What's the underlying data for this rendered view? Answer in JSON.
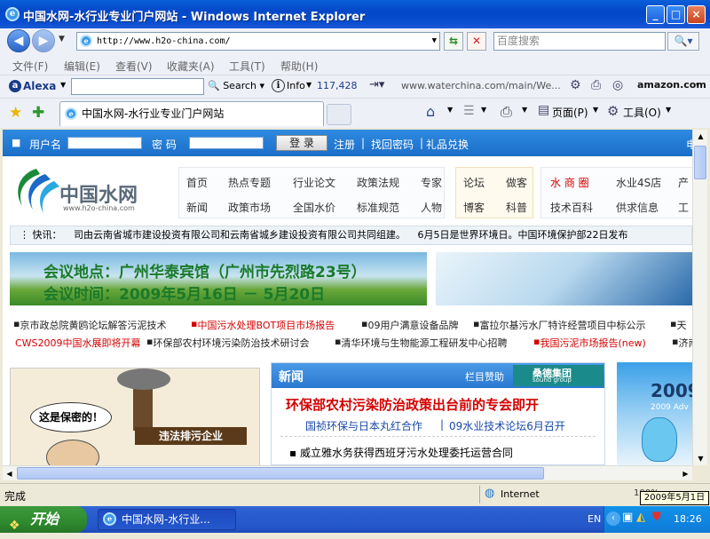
{
  "window": {
    "title": "中国水网-水行业专业门户网站 - Windows Internet Explorer",
    "minimize": "_",
    "maximize": "□",
    "close": "×"
  },
  "navbar": {
    "address": "http://www.h2o-china.com/",
    "search_placeholder": "百度搜索"
  },
  "menu": [
    "文件(F)",
    "编辑(E)",
    "查看(V)",
    "收藏夹(A)",
    "工具(T)",
    "帮助(H)"
  ],
  "alexa": {
    "brand": "Alexa",
    "search": "Search",
    "info": "Info",
    "rank": "117,428",
    "url": "www.waterchina.com/main/We...",
    "amazon": "amazon.com"
  },
  "tabs": {
    "active": "中国水网-水行业专业门户网站",
    "page_menu": "页面(P)",
    "tools_menu": "工具(O)"
  },
  "page": {
    "login": {
      "username_label": "用户名",
      "password_label": "密  码",
      "login_button": "登 录",
      "register": "注册",
      "find_password": "找回密码",
      "gift": "礼品兑换"
    },
    "logo": {
      "cn": "中国水网",
      "url": "www.h2o-china.com"
    },
    "nav_row1": [
      "首页",
      "热点专题",
      "行业论文",
      "政策法规",
      "专家"
    ],
    "nav_row2": [
      "新闻",
      "政策市场",
      "全国水价",
      "标准规范",
      "人物"
    ],
    "nav_mid1": [
      "论坛",
      "做客"
    ],
    "nav_mid2": [
      "博客",
      "科普"
    ],
    "nav_right1": [
      "水 商 圈",
      "水业4S店",
      "产"
    ],
    "nav_right2": [
      "技术百科",
      "供求信息",
      "工"
    ],
    "ticker_label": "快讯：",
    "ticker_text": "司由云南省城市建设投资有限公司和云南省城乡建设投资有限公司共同组建。",
    "ticker_text2": "6月5日是世界环境日。中国环境保护部22日发布",
    "banner": {
      "line1": "会议地点：广州华泰宾馆（广州市先烈路23号）",
      "line2": "会议时间：2009年5月16日 － 5月20日"
    },
    "links_row1": [
      "京市政总院黄鸥论坛解答污泥技术",
      "中国污水处理BOT项目市场报告",
      "09用户满意设备品牌",
      "富拉尔基污水厂特许经营项目中标公示",
      "天"
    ],
    "links_row2": [
      "CWS2009中国水展即将开幕",
      "环保部农村环境污染防治技术研讨会",
      "清华环境与生物能源工程研发中心招聘",
      "我国污泥市场报告(new)",
      "济南"
    ],
    "cartoon": {
      "bubble": "这是保密的！",
      "sign": "违法排污企业"
    },
    "news": {
      "header": "新闻",
      "sponsor": "栏目赞助",
      "sponsor_name": "桑德集团",
      "sponsor_en": "sound group",
      "headline": "环保部农村污染防治政策出台前的专会即开",
      "sub1": "国祯环保与日本丸红合作",
      "sub2": "09水业技术论坛6月召开",
      "item1": "威立雅水务获得西班牙污水处理委托运营合同"
    },
    "ad": {
      "year": "2009",
      "sub": "2009 Adv"
    }
  },
  "status": {
    "text": "完成",
    "zone": "Internet",
    "zoom": "100%"
  },
  "taskbar": {
    "start": "开始",
    "task": "中国水网-水行业...",
    "lang": "EN",
    "clock": "18:26",
    "tooltip": "2009年5月1日"
  }
}
